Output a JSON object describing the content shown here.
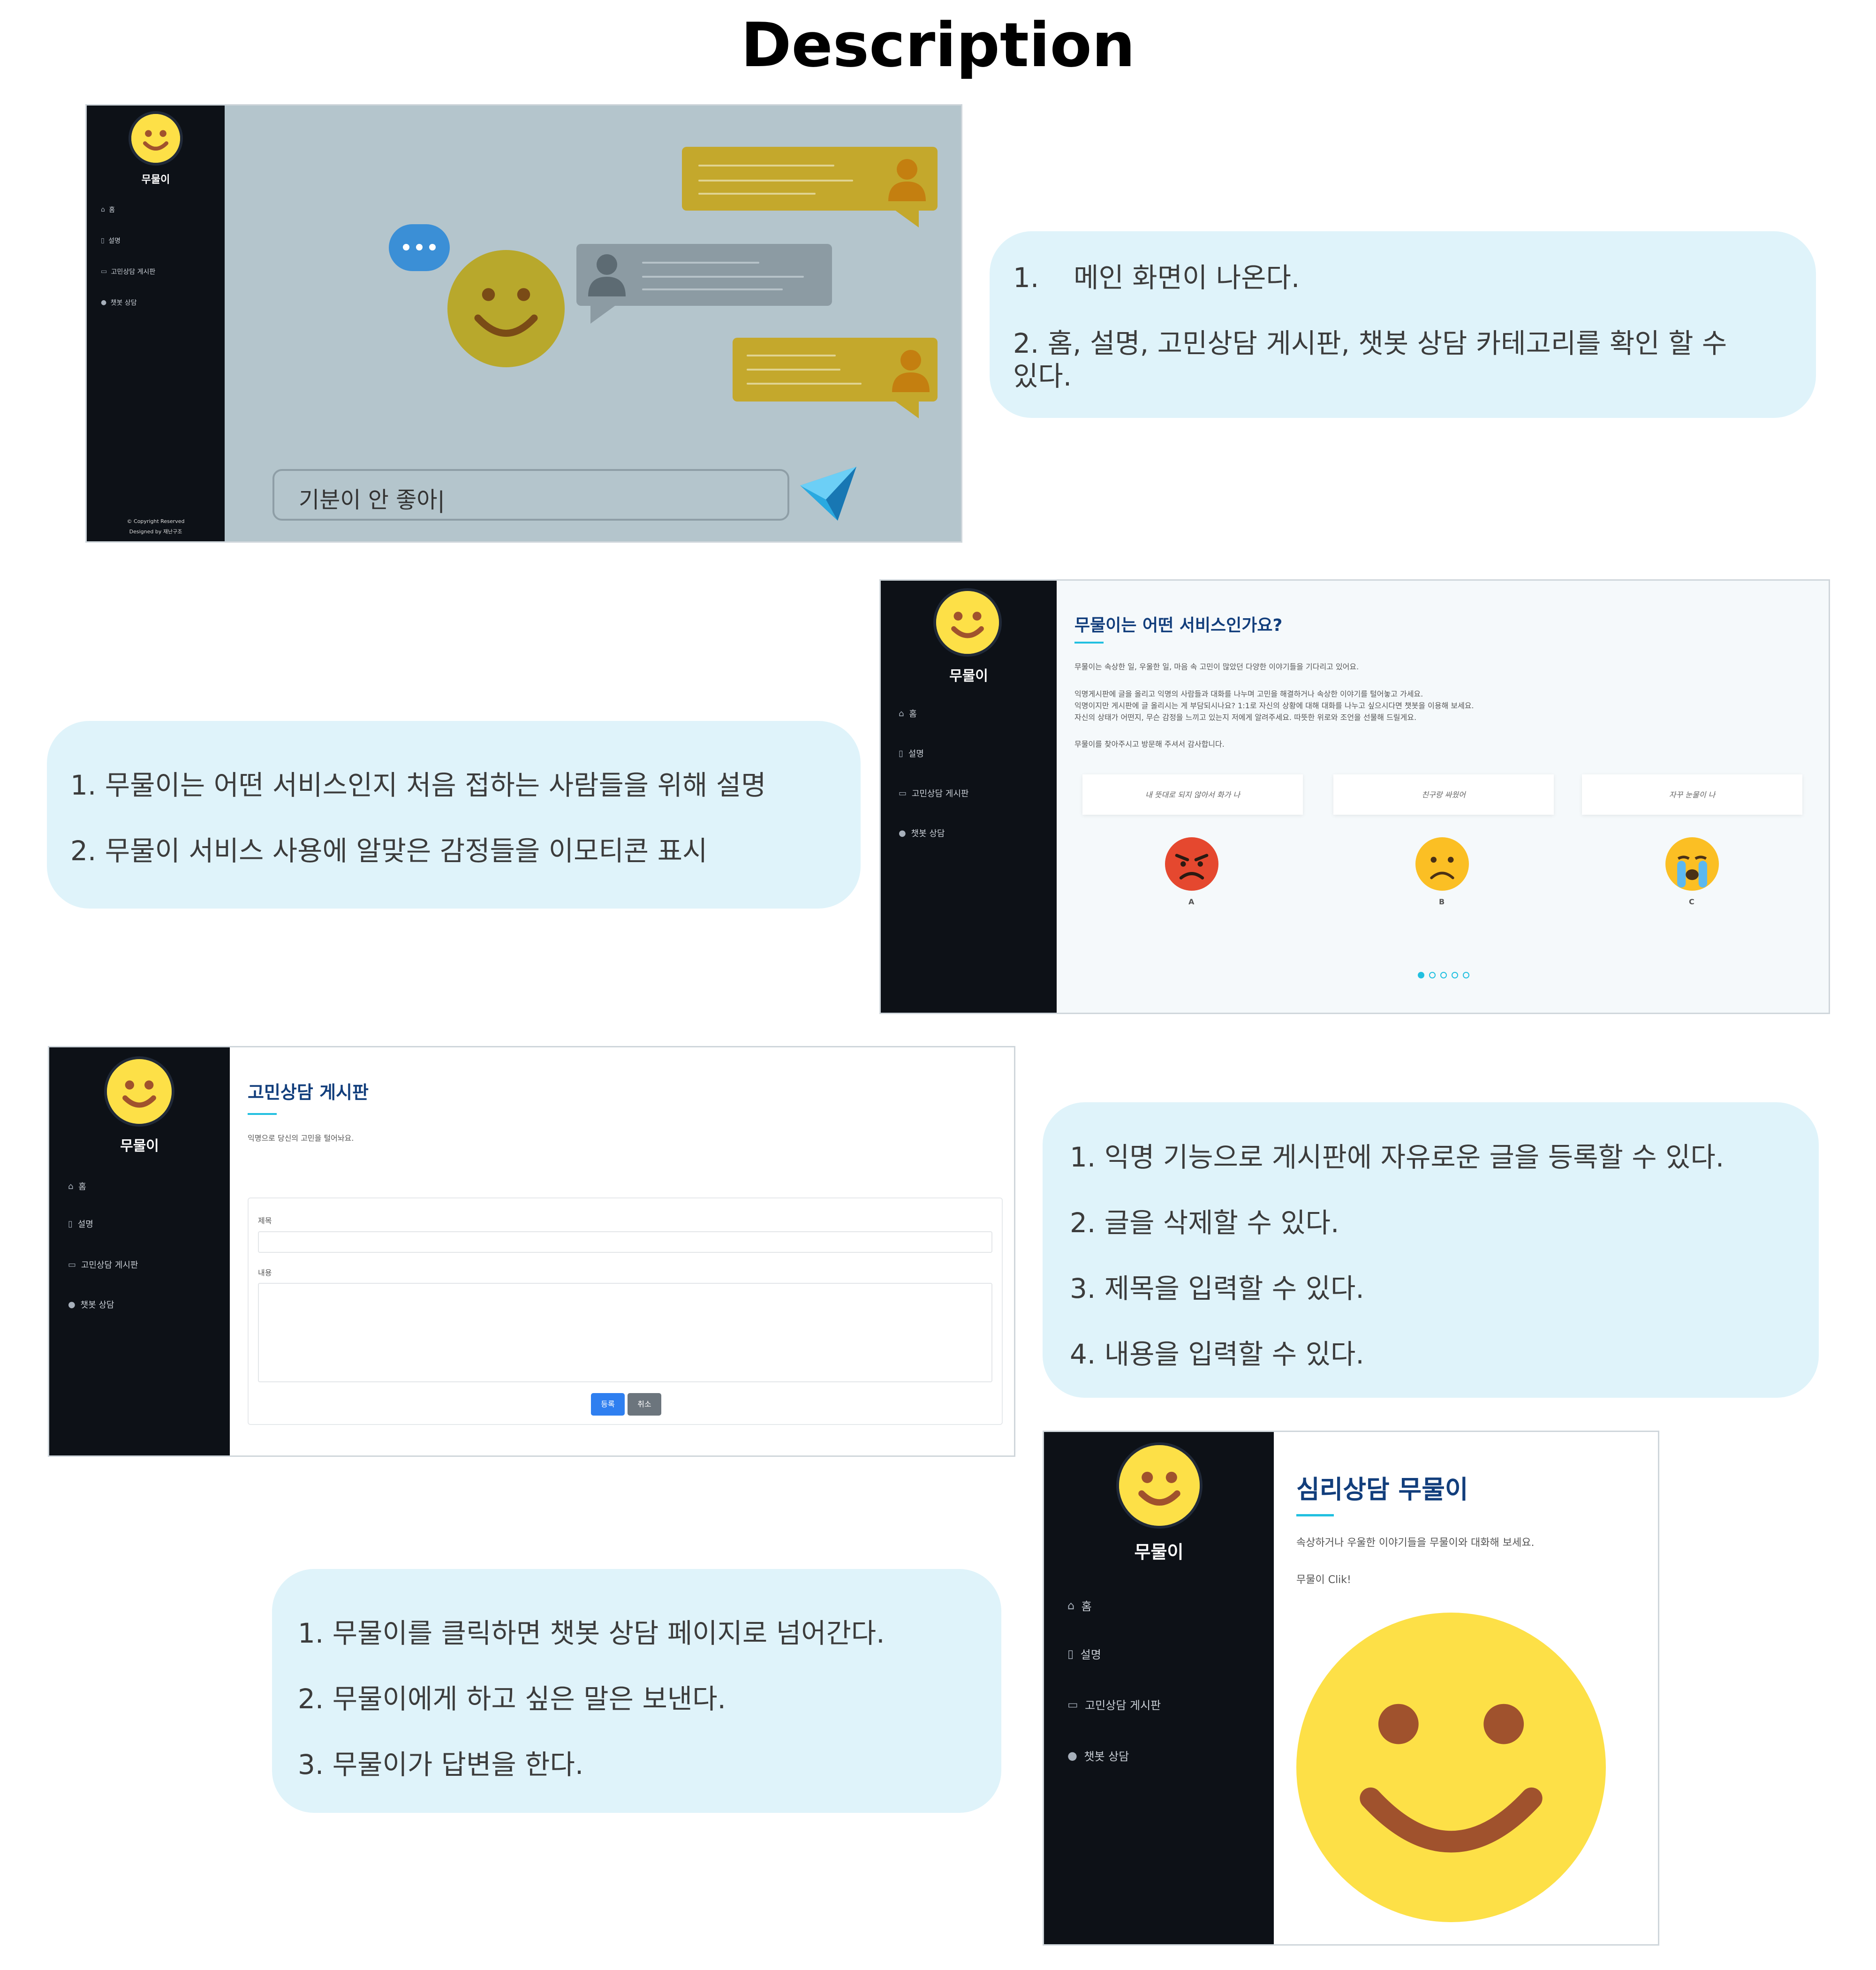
{
  "page": {
    "title": "Description"
  },
  "app": {
    "brand": "무물이",
    "nav": [
      "홈",
      "설명",
      "고민상담 게시판",
      "챗봇 상담"
    ],
    "footer": {
      "line1": "© Copyright Reserved",
      "line2": "Designed by 재난구조"
    }
  },
  "shot1": {
    "input_text": "기분이 안 좋아|"
  },
  "bubble1": {
    "line1": "1.    메인 화면이 나온다.",
    "line2a": "2. 홈, 설명, 고민상담 게시판, 챗봇 상담 카테고리를 확인 할 수",
    "line2b": "있다."
  },
  "shot2": {
    "title": "무물이는 어떤 서비스인가요?",
    "p1": "무물이는 속상한 일, 우울한 일, 마음 속 고민이 많았던 다양한 이야기들을 기다리고 있어요.",
    "p2": "익명게시판에 글을 올리고 익명의 사람들과 대화를 나누며 고민을 해결하거나 속상한 이야기를 털어놓고 가세요.",
    "p3": "익명이지만 게시판에 글 올리시는 게 부담되시나요? 1:1로 자신의 상황에 대해 대화를 나누고 싶으시다면 챗봇을 이용해 보세요.",
    "p4": "자신의 상태가 어떤지, 무슨 감정을 느끼고 있는지 저에게 알려주세요. 따뜻한 위로와 조언을 선물해 드릴게요.",
    "p5": "무물이를 찾아주시고 방문해 주셔서 감사합니다.",
    "cards": [
      {
        "quote": "내 뜻대로 되지 않아서 화가 나",
        "label": "A",
        "emoji": "angry-face"
      },
      {
        "quote": "친구랑 싸웠어",
        "label": "B",
        "emoji": "frowning-face"
      },
      {
        "quote": "자꾸 눈물이 나",
        "label": "C",
        "emoji": "crying-face"
      }
    ]
  },
  "bubble2": {
    "line1": "1. 무물이는 어떤 서비스인지 처음 접하는 사람들을 위해 설명",
    "line2": "2. 무물이 서비스 사용에 알맞은 감정들을 이모티콘 표시"
  },
  "shot3": {
    "title": "고민상담 게시판",
    "subtitle": "익명으로 당신의 고민을 털어놔요.",
    "label_title": "제목",
    "label_content": "내용",
    "btn_submit": "등록",
    "btn_cancel": "취소"
  },
  "bubble3": {
    "line1": "1. 익명 기능으로 게시판에 자유로운 글을 등록할 수 있다.",
    "line2": "2. 글을 삭제할 수 있다.",
    "line3": "3. 제목을 입력할 수 있다.",
    "line4": "4. 내용을 입력할 수 있다."
  },
  "shot4": {
    "title": "심리상담 무물이",
    "subtitle": "속상하거나 우울한 이야기들을 무물이와 대화해 보세요.",
    "cta": "무물이 Clik!"
  },
  "bubble4": {
    "line1": "1. 무물이를 클릭하면 챗봇 상담 페이지로 넘어간다.",
    "line2": "2. 무물이에게 하고 싶은 말은 보낸다.",
    "line3": "3. 무물이가 답변을 한다."
  },
  "colors": {
    "sidebar": "#0d1117",
    "bubble": "#dff3fa",
    "accent": "#22c0e0",
    "heading": "#123e7c",
    "smiley": "#fde047"
  }
}
